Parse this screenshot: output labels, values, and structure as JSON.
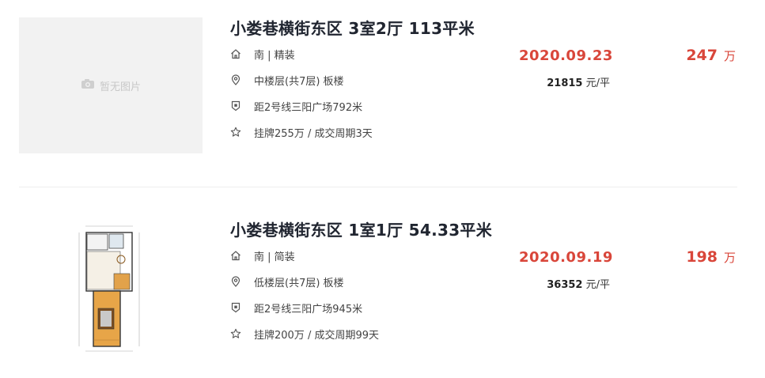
{
  "listings": [
    {
      "title": "小娄巷横街东区 3室2厅 113平米",
      "no_image_text": "暂无图片",
      "orientation": "南 | 精装",
      "floor": "中楼层(共7层) 板楼",
      "metro": "距2号线三阳广场792米",
      "listing_info": "挂牌255万 / 成交周期3天",
      "deal_date": "2020.09.23",
      "unit_price_value": "21815",
      "unit_price_unit": "元/平",
      "total_price": "247",
      "total_unit": "万"
    },
    {
      "title": "小娄巷横街东区 1室1厅 54.33平米",
      "orientation": "南 | 简装",
      "floor": "低楼层(共7层) 板楼",
      "metro": "距2号线三阳广场945米",
      "listing_info": "挂牌200万 / 成交周期99天",
      "deal_date": "2020.09.19",
      "unit_price_value": "36352",
      "unit_price_unit": "元/平",
      "total_price": "198",
      "total_unit": "万"
    }
  ],
  "icons": {
    "house": "house-icon",
    "location": "location-pin-icon",
    "metro": "metro-icon",
    "star": "star-icon",
    "camera": "camera-icon"
  },
  "colors": {
    "accent": "#d9463a",
    "title": "#202530",
    "placeholder_bg": "#f2f2f2"
  }
}
